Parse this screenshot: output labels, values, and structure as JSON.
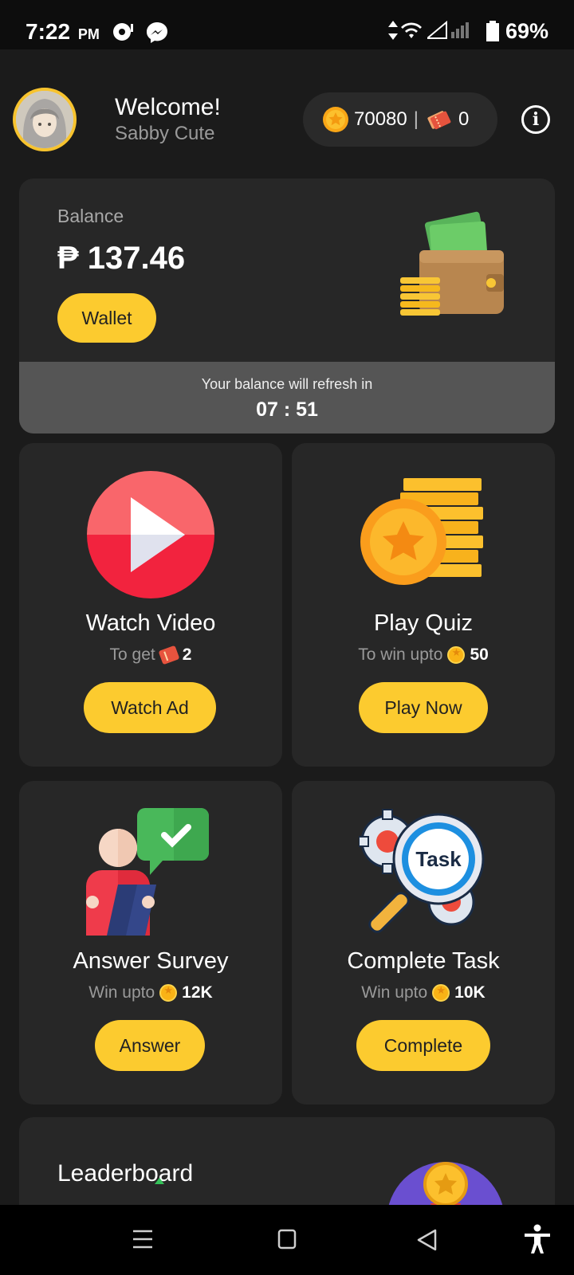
{
  "status_bar": {
    "time": "7:22",
    "ampm": "PM",
    "battery": "69%"
  },
  "header": {
    "welcome": "Welcome!",
    "username": "Sabby Cute",
    "coins": "70080",
    "separator": "|",
    "tickets": "0"
  },
  "balance": {
    "label": "Balance",
    "amount": "₱ 137.46",
    "wallet_button": "Wallet",
    "refresh_text": "Your balance will refresh in",
    "refresh_timer": "07 : 51"
  },
  "tiles": [
    {
      "title": "Watch Video",
      "sub_prefix": "To get",
      "sub_value": "2",
      "button": "Watch Ad"
    },
    {
      "title": "Play Quiz",
      "sub_prefix": "To win upto",
      "sub_value": "50",
      "button": "Play Now"
    },
    {
      "title": "Answer Survey",
      "sub_prefix": "Win upto",
      "sub_value": "12K",
      "button": "Answer"
    },
    {
      "title": "Complete Task",
      "sub_prefix": "Win upto",
      "sub_value": "10K",
      "button": "Complete"
    }
  ],
  "task_icon_label": "Task",
  "leaderboard": {
    "title": "Leaderboard"
  },
  "colors": {
    "background": "#1b1b1b",
    "card": "#272727",
    "accent_yellow": "#fccb2f",
    "refresh_bar": "#555555"
  }
}
